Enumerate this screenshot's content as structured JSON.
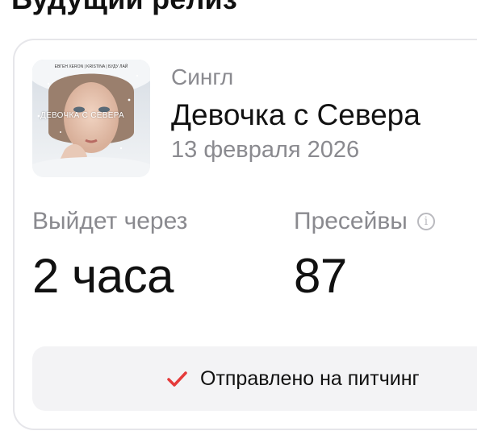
{
  "header": {
    "section_title": "Будущий релиз"
  },
  "release": {
    "cover": {
      "top_text": "ЕВГЕН XERON | KRISTINA | БУДУ ЛАЙ",
      "overlay_text": "ДЕВОЧКА С СЕВЕРА"
    },
    "type": "Сингл",
    "title": "Девочка с Севера",
    "date": "13 февраля 2026"
  },
  "stats": {
    "countdown": {
      "label": "Выйдет через",
      "value": "2 часа"
    },
    "presaves": {
      "label": "Пресейвы",
      "value": "87",
      "info_icon": "info-icon"
    }
  },
  "pitch": {
    "status": "Отправлено на питчинг",
    "icon": "check-icon",
    "check_color": "#e53a3a"
  }
}
